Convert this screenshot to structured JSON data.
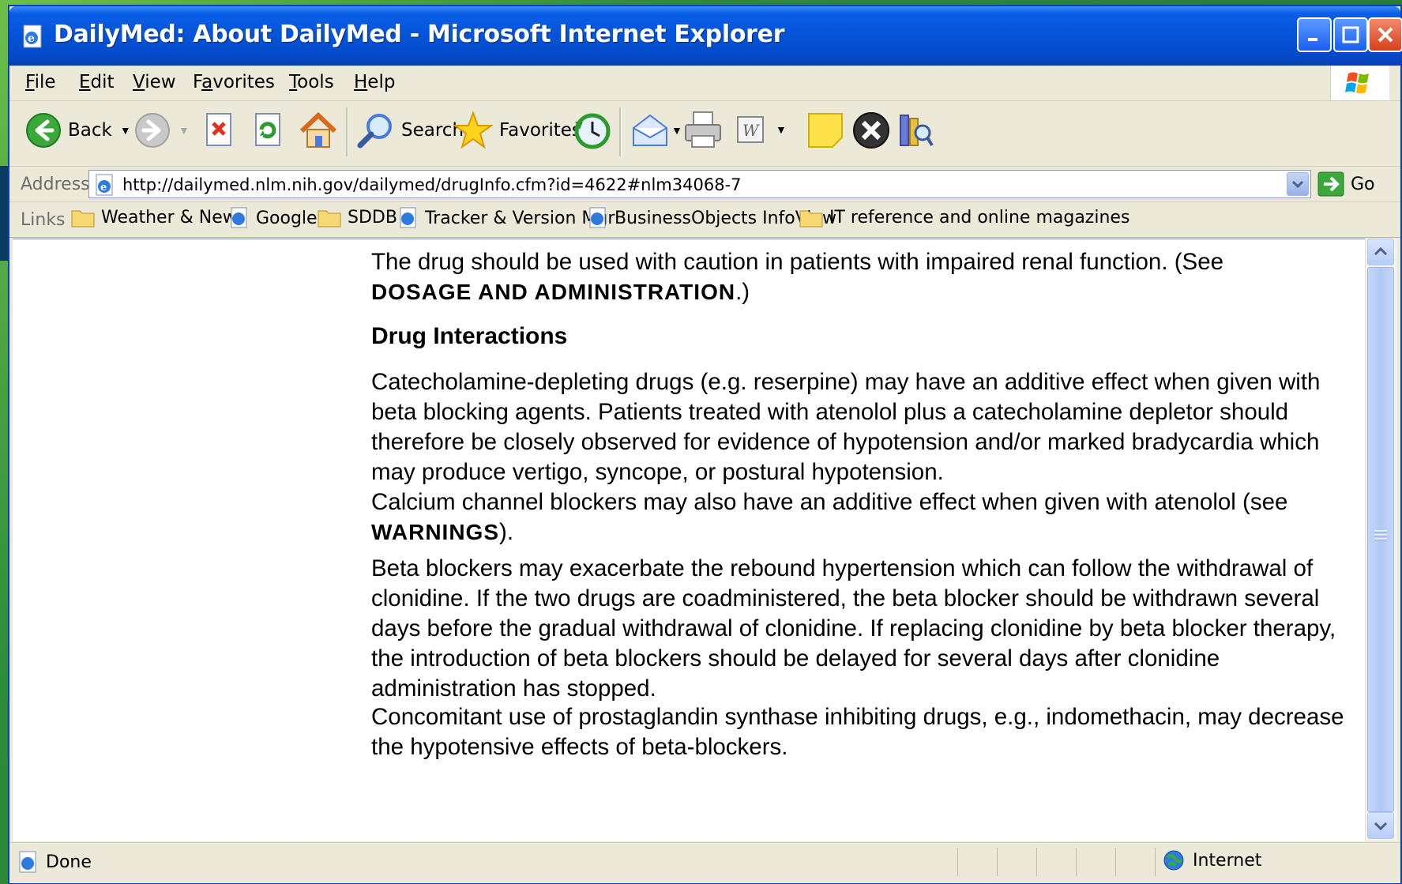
{
  "window": {
    "title": "DailyMed: About DailyMed - Microsoft Internet Explorer"
  },
  "menu": [
    {
      "label": "File",
      "accel": "F"
    },
    {
      "label": "Edit",
      "accel": "E"
    },
    {
      "label": "View",
      "accel": "V"
    },
    {
      "label": "Favorites",
      "accel": "a"
    },
    {
      "label": "Tools",
      "accel": "T"
    },
    {
      "label": "Help",
      "accel": "H"
    }
  ],
  "toolbar": {
    "back_label": "Back",
    "search_label": "Search",
    "favorites_label": "Favorites"
  },
  "address": {
    "label": "Address",
    "url": "http://dailymed.nlm.nih.gov/dailymed/drugInfo.cfm?id=4622#nlm34068-7",
    "go_label": "Go"
  },
  "links": {
    "label": "Links",
    "items": [
      {
        "label": "Weather & News",
        "icon": "folder-icon"
      },
      {
        "label": "Google",
        "icon": "ie-page-icon"
      },
      {
        "label": "SDDB",
        "icon": "folder-icon"
      },
      {
        "label": "Tracker & Version Mgr",
        "icon": "ie-page-icon"
      },
      {
        "label": "BusinessObjects InfoView",
        "icon": "ie-page-icon"
      },
      {
        "label": "IT reference and online magazines",
        "icon": "folder-icon"
      }
    ]
  },
  "content": {
    "p0_text": "The drug should be used with caution in patients with impaired renal function. (See",
    "p0_ref": "DOSAGE AND ADMINISTRATION",
    "p0_tail": ".)",
    "heading": "Drug Interactions",
    "p1": "Catecholamine-depleting drugs (e.g. reserpine) may have an additive effect when given with beta blocking agents. Patients treated with atenolol plus a catecholamine depletor should therefore be closely observed for evidence of hypotension and/or marked bradycardia which may produce vertigo, syncope, or postural hypotension.",
    "p2_text": "Calcium channel blockers may also have an additive effect when given with atenolol (see ",
    "p2_ref": "WARNINGS",
    "p2_tail": ").",
    "p3": "Beta blockers may exacerbate the rebound hypertension which can follow the withdrawal of clonidine. If the two drugs are coadministered, the beta blocker should be withdrawn several days before the gradual withdrawal of clonidine. If replacing clonidine by beta blocker therapy, the introduction of beta blockers should be delayed for several days after clonidine administration has stopped.",
    "p4": "Concomitant use of prostaglandin synthase inhibiting drugs, e.g., indomethacin, may decrease the hypotensive effects of beta-blockers."
  },
  "status": {
    "text": "Done",
    "zone": "Internet"
  },
  "colors": {
    "titlebar": "#0553d8",
    "chrome": "#ece9d8",
    "desktop": "#2e8b3a"
  }
}
